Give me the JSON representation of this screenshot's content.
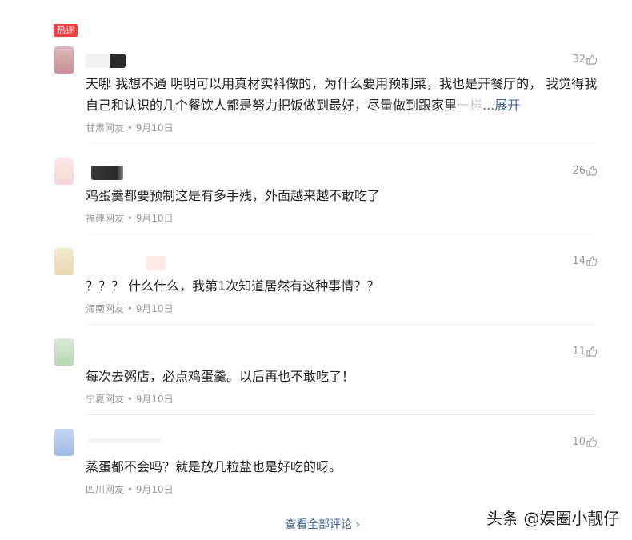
{
  "hot_label": "热评",
  "comments": [
    {
      "text_main": "天哪 我想不通 明明可以用真材实料做的，为什么要用预制菜，我也是开餐厅的， 我觉得我自己和认识的几个餐饮人都是努力把饭做到最好，尽量做到跟家里",
      "text_fade": "一样",
      "more_label": "...展开",
      "location": "甘肃网友",
      "date": "9月10日",
      "likes": "32",
      "avatar_color": "#c98f98"
    },
    {
      "text_main": "鸡蛋羹都要预制这是有多手残，外面越来越不敢吃了",
      "location": "福建网友",
      "date": "9月10日",
      "likes": "26",
      "avatar_color": "#f3d7d8"
    },
    {
      "text_main": "？？？ 什么什么，我第1次知道居然有这种事情？？",
      "location": "海南网友",
      "date": "9月10日",
      "likes": "14",
      "avatar_color": "#e9d9b3"
    },
    {
      "text_main": "每次去粥店，必点鸡蛋羹。以后再也不敢吃了！",
      "location": "宁夏网友",
      "date": "9月10日",
      "likes": "11",
      "avatar_color": "#b8d6b4"
    },
    {
      "text_main": "蒸蛋都不会吗？就是放几粒盐也是好吃的呀。",
      "location": "四川网友",
      "date": "9月10日",
      "likes": "10",
      "avatar_color": "#9fb9e6"
    }
  ],
  "meta_separator": "•",
  "view_all_label": "查看全部评论",
  "view_all_chevron": "›",
  "watermark": "头条 @娱圈小靓仔",
  "colors": {
    "badge": "#f04142",
    "link": "#406599",
    "meta": "#999999"
  }
}
